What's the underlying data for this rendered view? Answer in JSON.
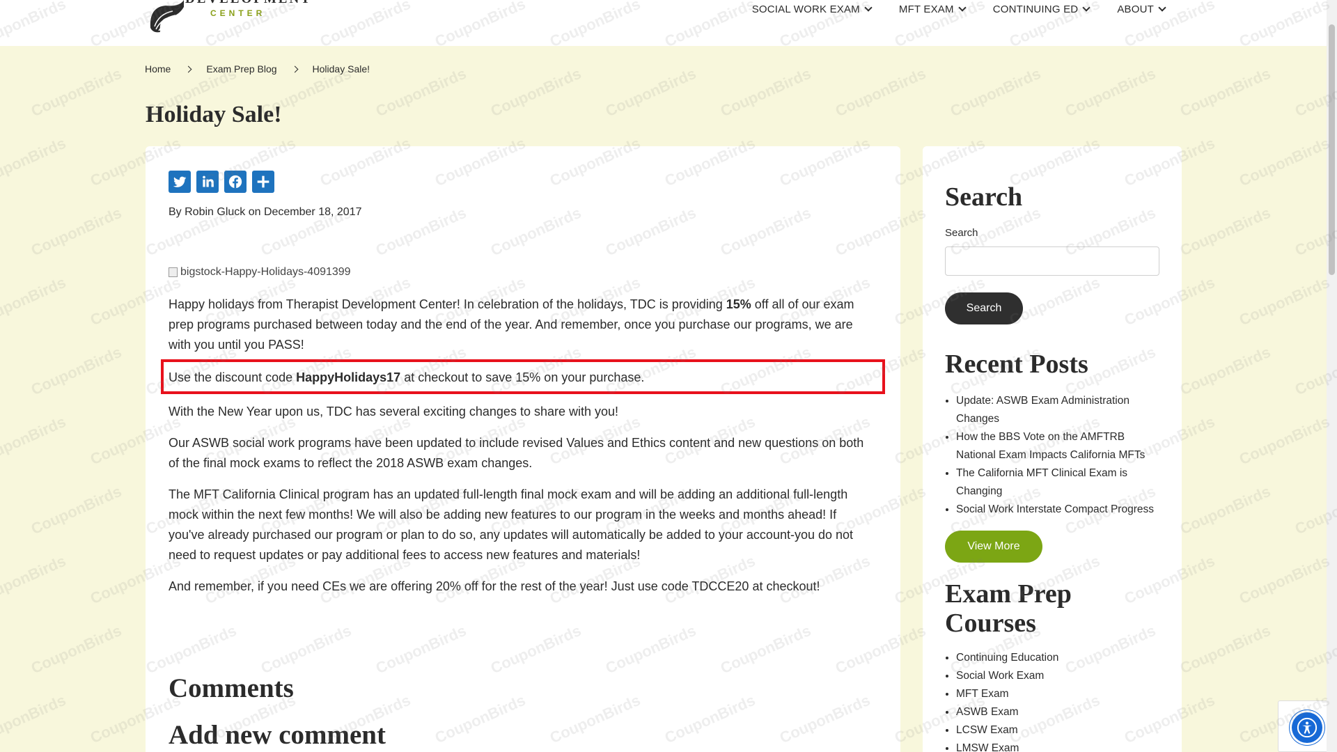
{
  "site": {
    "logo_line1": "DEVELOPMENT",
    "logo_line2": "CENTER"
  },
  "nav": [
    {
      "label": "SOCIAL WORK EXAM"
    },
    {
      "label": "MFT EXAM"
    },
    {
      "label": "CONTINUING ED"
    },
    {
      "label": "ABOUT"
    }
  ],
  "breadcrumb": [
    {
      "label": "Home"
    },
    {
      "label": "Exam Prep Blog"
    },
    {
      "label": "Holiday Sale!"
    }
  ],
  "page_title": "Holiday Sale!",
  "post": {
    "byline": "By Robin Gluck on December 18, 2017",
    "image_alt": "bigstock-Happy-Holidays-4091399",
    "p1_before": "Happy holidays from Therapist Development Center! In celebration of the holidays, TDC is providing ",
    "p1_bold": "15%",
    "p1_after": " off all of our exam prep programs purchased between today and the end of the year. And remember, once you purchase our programs, we are with you until you PASS!",
    "p2_before": "Use the discount code ",
    "p2_code": "HappyHolidays17",
    "p2_after": " at checkout to save 15% on your purchase.",
    "p3": "With the New Year upon us, TDC has several exciting changes to share with you!",
    "p4": "Our ASWB social work programs have been updated to include revised Values and Ethics content and new questions on both of the final mock exams to reflect the 2018 ASWB exam changes.",
    "p5": "The MFT California Clinical program has an updated full-length final mock exam and will be adding an additional full-length mock within the next few months! We will also be adding new features to our program in the weeks and months ahead! If you've already purchased our program or plan to do so, any updates will automatically be added to your account-you do not need to request updates or pay additional fees to access new features and materials!",
    "p6": "And remember, if you need CEs we are offering 20% off for the rest of the year! Just use code TDCCE20 at checkout!",
    "comments_heading": "Comments",
    "add_comment_heading": "Add new comment"
  },
  "share_icons": [
    "twitter-icon",
    "linkedin-icon",
    "facebook-icon",
    "share-icon"
  ],
  "sidebar": {
    "search_heading": "Search",
    "search_label": "Search",
    "search_placeholder": "",
    "search_button": "Search",
    "recent_heading": "Recent Posts",
    "recent_posts": [
      "Update: ASWB Exam Administration Changes",
      "How the BBS Vote on the AMFTRB National Exam Impacts California MFTs",
      "The California MFT Clinical Exam is Changing",
      "Social Work Interstate Compact Progress"
    ],
    "view_more": "View More",
    "courses_heading": "Exam Prep Courses",
    "courses": [
      "Continuing Education",
      "Social Work Exam",
      "MFT Exam",
      "ASWB Exam",
      "LCSW Exam",
      "LMSW Exam"
    ]
  },
  "watermark": "CouponBirds",
  "colors": {
    "background": "#f8f7dc",
    "accent_green": "#7ca614",
    "share_blue": "#1e73be",
    "highlight_red": "#e8111c",
    "dark_button": "#2f2f2f",
    "a11y_blue": "#1769d6"
  }
}
